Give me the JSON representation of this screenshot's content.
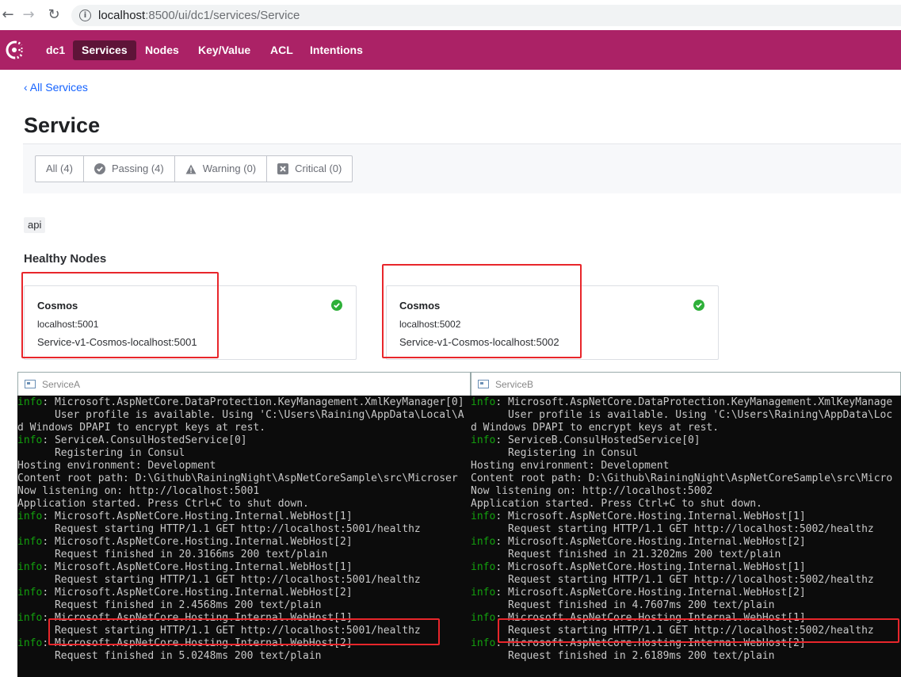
{
  "browser": {
    "url_host": "localhost",
    "url_path": ":8500/ui/dc1/services/Service",
    "back_glyph": "←",
    "forward_glyph": "→",
    "reload_glyph": "↻",
    "info_glyph": "i"
  },
  "nav": {
    "items": [
      {
        "label": "dc1",
        "active": false
      },
      {
        "label": "Services",
        "active": true
      },
      {
        "label": "Nodes",
        "active": false
      },
      {
        "label": "Key/Value",
        "active": false
      },
      {
        "label": "ACL",
        "active": false
      },
      {
        "label": "Intentions",
        "active": false
      }
    ]
  },
  "page": {
    "back_link": "‹ All Services",
    "title": "Service",
    "filters": [
      {
        "label": "All (4)",
        "icon": ""
      },
      {
        "label": "Passing (4)",
        "icon": "check-circle-icon"
      },
      {
        "label": "Warning (0)",
        "icon": "warning-icon"
      },
      {
        "label": "Critical (0)",
        "icon": "critical-x-icon"
      }
    ],
    "tag": "api",
    "section_title": "Healthy Nodes",
    "nodes": [
      {
        "name": "Cosmos",
        "address": "localhost:5001",
        "service_id": "Service-v1-Cosmos-localhost:5001"
      },
      {
        "name": "Cosmos",
        "address": "localhost:5002",
        "service_id": "Service-v1-Cosmos-localhost:5002"
      }
    ]
  },
  "colors": {
    "brand": "#ab2266",
    "brand_active": "#5e1438",
    "link": "#1563ff",
    "passing": "#2eb039",
    "highlight": "#e8262b",
    "console_info": "#13a10e"
  },
  "consoles": [
    {
      "title": "ServiceA",
      "lines": [
        {
          "lvl": "info",
          "text": ": Microsoft.AspNetCore.DataProtection.KeyManagement.XmlKeyManager[0]"
        },
        {
          "lvl": "",
          "text": "      User profile is available. Using 'C:\\Users\\Raining\\AppData\\Local\\A"
        },
        {
          "lvl": "",
          "text": "d Windows DPAPI to encrypt keys at rest."
        },
        {
          "lvl": "info",
          "text": ": ServiceA.ConsulHostedService[0]"
        },
        {
          "lvl": "",
          "text": "      Registering in Consul"
        },
        {
          "lvl": "",
          "text": "Hosting environment: Development"
        },
        {
          "lvl": "",
          "text": "Content root path: D:\\Github\\RainingNight\\AspNetCoreSample\\src\\Microser"
        },
        {
          "lvl": "",
          "text": "Now listening on: http://localhost:5001"
        },
        {
          "lvl": "",
          "text": "Application started. Press Ctrl+C to shut down."
        },
        {
          "lvl": "info",
          "text": ": Microsoft.AspNetCore.Hosting.Internal.WebHost[1]"
        },
        {
          "lvl": "",
          "text": "      Request starting HTTP/1.1 GET http://localhost:5001/healthz"
        },
        {
          "lvl": "info",
          "text": ": Microsoft.AspNetCore.Hosting.Internal.WebHost[2]"
        },
        {
          "lvl": "",
          "text": "      Request finished in 20.3166ms 200 text/plain"
        },
        {
          "lvl": "info",
          "text": ": Microsoft.AspNetCore.Hosting.Internal.WebHost[1]"
        },
        {
          "lvl": "",
          "text": "      Request starting HTTP/1.1 GET http://localhost:5001/healthz"
        },
        {
          "lvl": "info",
          "text": ": Microsoft.AspNetCore.Hosting.Internal.WebHost[2]"
        },
        {
          "lvl": "",
          "text": "      Request finished in 2.4568ms 200 text/plain"
        },
        {
          "lvl": "info",
          "text": ": Microsoft.AspNetCore.Hosting.Internal.WebHost[1]"
        },
        {
          "lvl": "",
          "text": "      Request starting HTTP/1.1 GET http://localhost:5001/healthz"
        },
        {
          "lvl": "info",
          "text": ": Microsoft.AspNetCore.Hosting.Internal.WebHost[2]"
        },
        {
          "lvl": "",
          "text": "      Request finished in 5.0248ms 200 text/plain"
        }
      ]
    },
    {
      "title": "ServiceB",
      "lines": [
        {
          "lvl": "info",
          "text": ": Microsoft.AspNetCore.DataProtection.KeyManagement.XmlKeyManage"
        },
        {
          "lvl": "",
          "text": "      User profile is available. Using 'C:\\Users\\Raining\\AppData\\Loc"
        },
        {
          "lvl": "",
          "text": "d Windows DPAPI to encrypt keys at rest."
        },
        {
          "lvl": "info",
          "text": ": ServiceB.ConsulHostedService[0]"
        },
        {
          "lvl": "",
          "text": "      Registering in Consul"
        },
        {
          "lvl": "",
          "text": "Hosting environment: Development"
        },
        {
          "lvl": "",
          "text": "Content root path: D:\\Github\\RainingNight\\AspNetCoreSample\\src\\Micro"
        },
        {
          "lvl": "",
          "text": "Now listening on: http://localhost:5002"
        },
        {
          "lvl": "",
          "text": "Application started. Press Ctrl+C to shut down."
        },
        {
          "lvl": "info",
          "text": ": Microsoft.AspNetCore.Hosting.Internal.WebHost[1]"
        },
        {
          "lvl": "",
          "text": "      Request starting HTTP/1.1 GET http://localhost:5002/healthz"
        },
        {
          "lvl": "info",
          "text": ": Microsoft.AspNetCore.Hosting.Internal.WebHost[2]"
        },
        {
          "lvl": "",
          "text": "      Request finished in 21.3202ms 200 text/plain"
        },
        {
          "lvl": "info",
          "text": ": Microsoft.AspNetCore.Hosting.Internal.WebHost[1]"
        },
        {
          "lvl": "",
          "text": "      Request starting HTTP/1.1 GET http://localhost:5002/healthz"
        },
        {
          "lvl": "info",
          "text": ": Microsoft.AspNetCore.Hosting.Internal.WebHost[2]"
        },
        {
          "lvl": "",
          "text": "      Request finished in 4.7607ms 200 text/plain"
        },
        {
          "lvl": "info",
          "text": ": Microsoft.AspNetCore.Hosting.Internal.WebHost[1]"
        },
        {
          "lvl": "",
          "text": "      Request starting HTTP/1.1 GET http://localhost:5002/healthz"
        },
        {
          "lvl": "info",
          "text": ": Microsoft.AspNetCore.Hosting.Internal.WebHost[2]"
        },
        {
          "lvl": "",
          "text": "      Request finished in 2.6189ms 200 text/plain"
        }
      ]
    }
  ]
}
